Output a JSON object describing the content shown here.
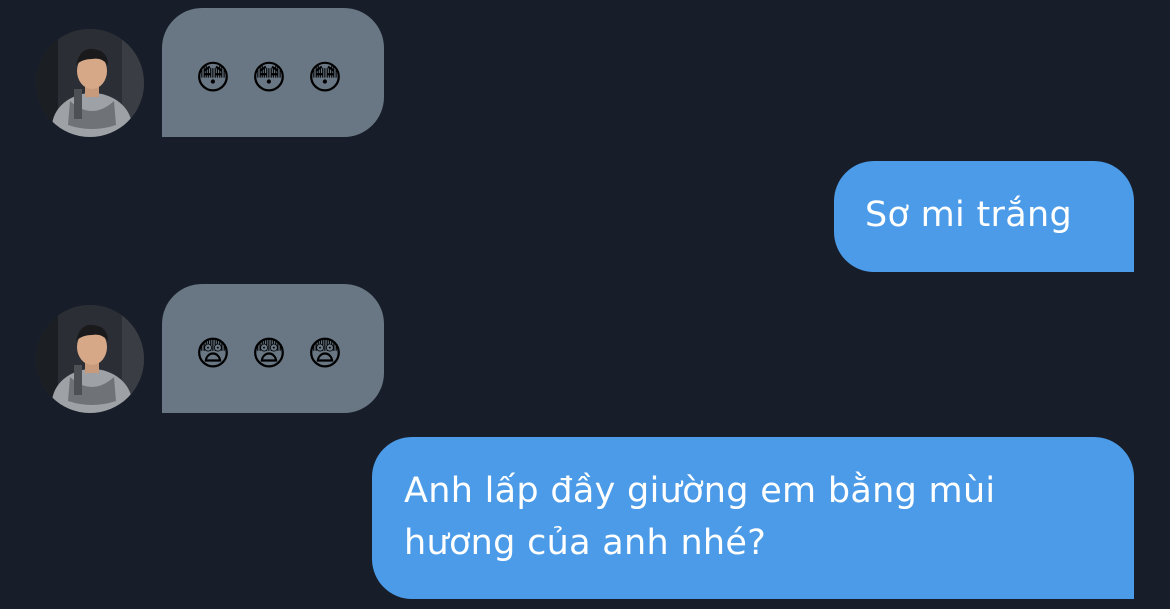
{
  "conversation": {
    "messages": [
      {
        "side": "incoming",
        "kind": "emoji",
        "emoji": [
          "😳",
          "😳",
          "😳"
        ]
      },
      {
        "side": "outgoing",
        "kind": "text",
        "text": "Sơ mi trắng"
      },
      {
        "side": "incoming",
        "kind": "emoji",
        "emoji": [
          "😨",
          "😨",
          "😨"
        ]
      },
      {
        "side": "outgoing",
        "kind": "text",
        "lines": [
          "Anh lấp đầy giường em bằng mùi",
          "hương của anh nhé?"
        ]
      }
    ]
  },
  "colors": {
    "background": "#171e29",
    "incoming_bubble": "#697784",
    "outgoing_bubble": "#4b9be8",
    "outgoing_text": "#ffffff"
  },
  "icons": {
    "avatar": "contact-avatar-photo"
  }
}
